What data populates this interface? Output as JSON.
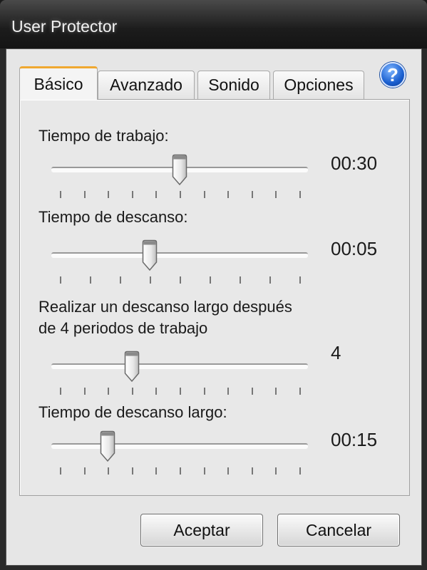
{
  "window": {
    "title": "User Protector"
  },
  "tabs": [
    {
      "label": "Básico",
      "active": true
    },
    {
      "label": "Avanzado",
      "active": false
    },
    {
      "label": "Sonido",
      "active": false
    },
    {
      "label": "Opciones",
      "active": false
    }
  ],
  "help_icon": "question-mark-circle",
  "sliders": [
    {
      "label": "Tiempo de trabajo:",
      "value_text": "00:30",
      "tick_count": 11,
      "position_tick": 5
    },
    {
      "label": "Tiempo de descanso:",
      "value_text": "00:05",
      "tick_count": 9,
      "position_tick": 3
    },
    {
      "label_line1": "Realizar un descanso largo después",
      "label_line2": "de 4 periodos de trabajo",
      "value_text": "4",
      "tick_count": 11,
      "position_tick": 3
    },
    {
      "label": "Tiempo de descanso largo:",
      "value_text": "00:15",
      "tick_count": 11,
      "position_tick": 2
    }
  ],
  "buttons": {
    "ok": "Aceptar",
    "cancel": "Cancelar"
  }
}
